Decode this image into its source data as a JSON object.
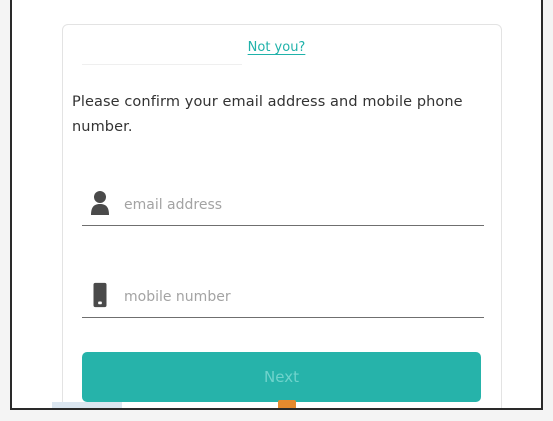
{
  "not_you_link": "Not you?",
  "prompt_text": "Please confirm your email address and mobile phone number.",
  "email_field": {
    "placeholder": "email address",
    "value": "",
    "icon": "person-icon"
  },
  "mobile_field": {
    "placeholder": "mobile number",
    "value": "",
    "icon": "mobile-phone-icon"
  },
  "next_button": {
    "label": "Next"
  },
  "colors": {
    "accent": "#26b3aa",
    "link": "#20b2aa",
    "button_text": "#6fd3cc",
    "icon": "#4a4a4a"
  }
}
